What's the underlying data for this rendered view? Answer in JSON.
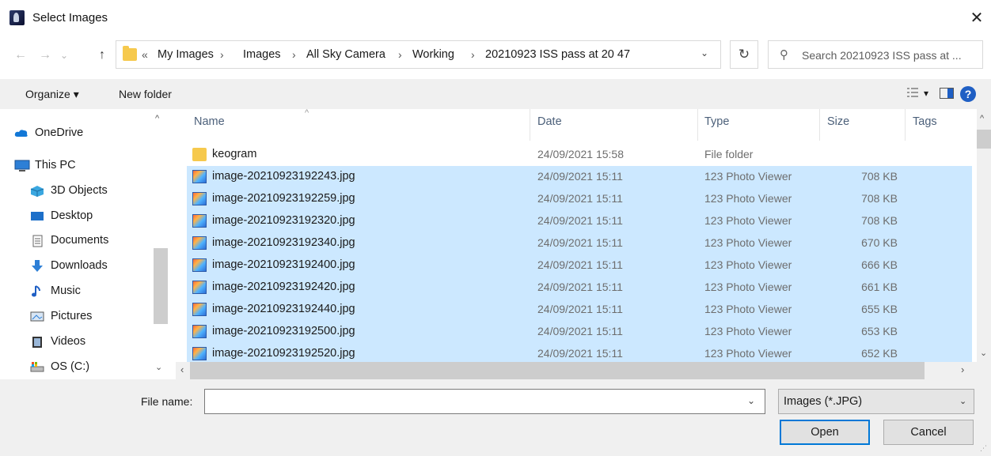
{
  "window": {
    "title": "Select Images",
    "close_glyph": "✕"
  },
  "nav": {
    "back_glyph": "←",
    "forward_glyph": "→",
    "recent_glyph": "⌄",
    "up_glyph": "↑",
    "breadcrumb_prefix": "«",
    "breadcrumbs": [
      "My Images",
      "Images",
      "All Sky Camera",
      "Working",
      "20210923 ISS pass at 20 47"
    ],
    "refresh_glyph": "↻",
    "search_placeholder": "Search 20210923 ISS pass at ..."
  },
  "toolbar": {
    "organize": "Organize ▾",
    "new_folder": "New folder",
    "view_glyph": "▾",
    "help": "?"
  },
  "sidebar": {
    "items": [
      {
        "label": "OneDrive",
        "icon": "cloud-icon"
      },
      {
        "label": "This PC",
        "icon": "computer-icon"
      },
      {
        "label": "3D Objects",
        "icon": "cube-icon"
      },
      {
        "label": "Desktop",
        "icon": "desktop-icon"
      },
      {
        "label": "Documents",
        "icon": "document-icon"
      },
      {
        "label": "Downloads",
        "icon": "download-icon"
      },
      {
        "label": "Music",
        "icon": "music-icon"
      },
      {
        "label": "Pictures",
        "icon": "pictures-icon"
      },
      {
        "label": "Videos",
        "icon": "video-icon"
      },
      {
        "label": "OS (C:)",
        "icon": "drive-icon"
      }
    ]
  },
  "columns": {
    "name": "Name",
    "date": "Date",
    "type": "Type",
    "size": "Size",
    "tags": "Tags"
  },
  "files": [
    {
      "name": "keogram",
      "date": "24/09/2021 15:58",
      "type": "File folder",
      "size": "",
      "selected": false,
      "icon": "folder-icon"
    },
    {
      "name": "image-20210923192243.jpg",
      "date": "24/09/2021 15:11",
      "type": "123 Photo Viewer",
      "size": "708 KB",
      "selected": true,
      "icon": "image-file-icon"
    },
    {
      "name": "image-20210923192259.jpg",
      "date": "24/09/2021 15:11",
      "type": "123 Photo Viewer",
      "size": "708 KB",
      "selected": true,
      "icon": "image-file-icon"
    },
    {
      "name": "image-20210923192320.jpg",
      "date": "24/09/2021 15:11",
      "type": "123 Photo Viewer",
      "size": "708 KB",
      "selected": true,
      "icon": "image-file-icon"
    },
    {
      "name": "image-20210923192340.jpg",
      "date": "24/09/2021 15:11",
      "type": "123 Photo Viewer",
      "size": "670 KB",
      "selected": true,
      "icon": "image-file-icon"
    },
    {
      "name": "image-20210923192400.jpg",
      "date": "24/09/2021 15:11",
      "type": "123 Photo Viewer",
      "size": "666 KB",
      "selected": true,
      "icon": "image-file-icon"
    },
    {
      "name": "image-20210923192420.jpg",
      "date": "24/09/2021 15:11",
      "type": "123 Photo Viewer",
      "size": "661 KB",
      "selected": true,
      "icon": "image-file-icon"
    },
    {
      "name": "image-20210923192440.jpg",
      "date": "24/09/2021 15:11",
      "type": "123 Photo Viewer",
      "size": "655 KB",
      "selected": true,
      "icon": "image-file-icon"
    },
    {
      "name": "image-20210923192500.jpg",
      "date": "24/09/2021 15:11",
      "type": "123 Photo Viewer",
      "size": "653 KB",
      "selected": true,
      "icon": "image-file-icon"
    },
    {
      "name": "image-20210923192520.jpg",
      "date": "24/09/2021 15:11",
      "type": "123 Photo Viewer",
      "size": "652 KB",
      "selected": true,
      "icon": "image-file-icon"
    }
  ],
  "footer": {
    "file_name_label": "File name:",
    "file_name_value": "",
    "filter_value": "Images (*.JPG)",
    "open_label": "Open",
    "cancel_label": "Cancel"
  },
  "colors": {
    "selection": "#cce8ff",
    "accent": "#0078d7",
    "folder": "#f6c94d"
  }
}
